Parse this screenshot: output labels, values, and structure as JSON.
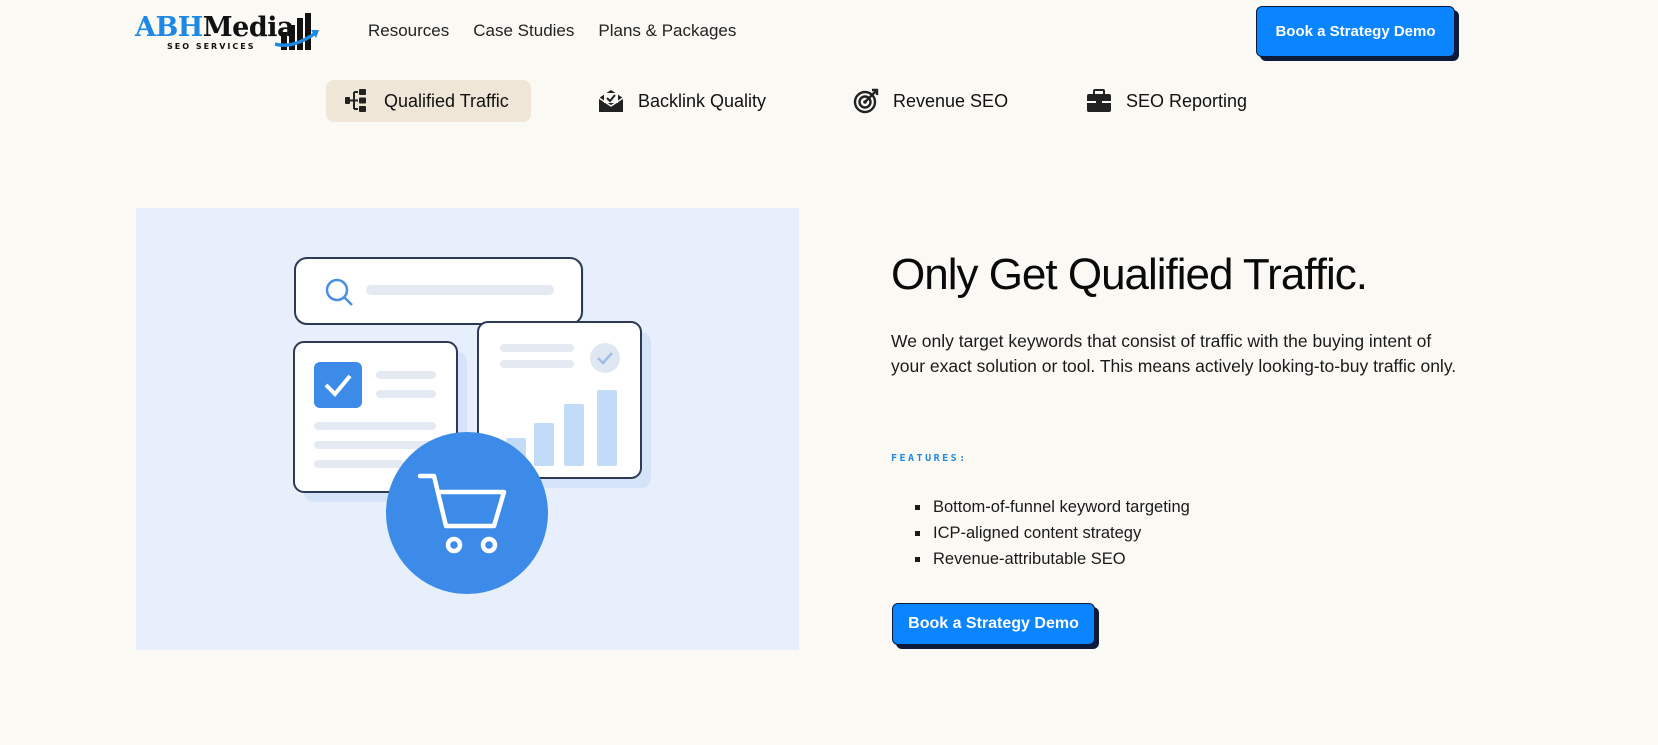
{
  "header": {
    "logo": {
      "name_blue": "ABH",
      "name_dark": "Media",
      "subtitle": "SEO SERVICES"
    },
    "nav": [
      "Resources",
      "Case Studies",
      "Plans & Packages"
    ],
    "cta_label": "Book a Strategy Demo"
  },
  "tabs": [
    {
      "label": "Qualified Traffic",
      "icon": "funnel-icon",
      "active": true
    },
    {
      "label": "Backlink Quality",
      "icon": "envelope-icon",
      "active": false
    },
    {
      "label": "Revenue SEO",
      "icon": "target-icon",
      "active": false
    },
    {
      "label": "SEO Reporting",
      "icon": "briefcase-icon",
      "active": false
    }
  ],
  "main": {
    "headline": "Only Get Qualified Traffic.",
    "description": "We only target keywords that consist of traffic with the buying intent of your exact solution or tool. This means actively looking-to-buy traffic only.",
    "features_label": "FEATURES:",
    "features": [
      "Bottom-of-funnel keyword targeting",
      "ICP-aligned content strategy",
      "Revenue-attributable SEO"
    ],
    "cta_label": "Book a Strategy Demo"
  },
  "colors": {
    "accent": "#0a84ff",
    "background": "#fbf9f4",
    "active_tab": "#f0e6d8",
    "illustration_bg": "#e6effb",
    "illustration_blue": "#3d8be8"
  }
}
